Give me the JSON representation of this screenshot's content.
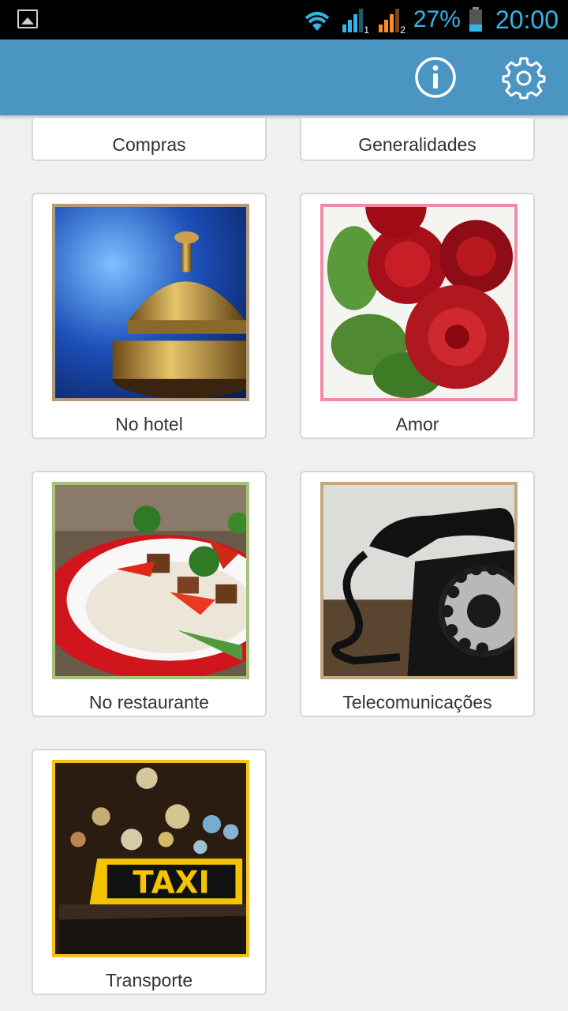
{
  "status_bar": {
    "battery": "27%",
    "time": "20:00",
    "sim1": "1",
    "sim2": "2"
  },
  "actionbar": {
    "info_icon": "info-icon",
    "settings_icon": "gear-icon"
  },
  "categories": [
    {
      "label": "Compras"
    },
    {
      "label": "Generalidades"
    },
    {
      "label": "No hotel",
      "image": "hotel-bell"
    },
    {
      "label": "Amor",
      "image": "red-roses"
    },
    {
      "label": "No restaurante",
      "image": "food-plate"
    },
    {
      "label": "Telecomunicações",
      "image": "rotary-phone"
    },
    {
      "label": "Transporte",
      "image": "taxi-sign",
      "sign_text": "TAXI"
    }
  ],
  "colors": {
    "actionbar": "#4a95c2",
    "status_text": "#33b5e5"
  }
}
